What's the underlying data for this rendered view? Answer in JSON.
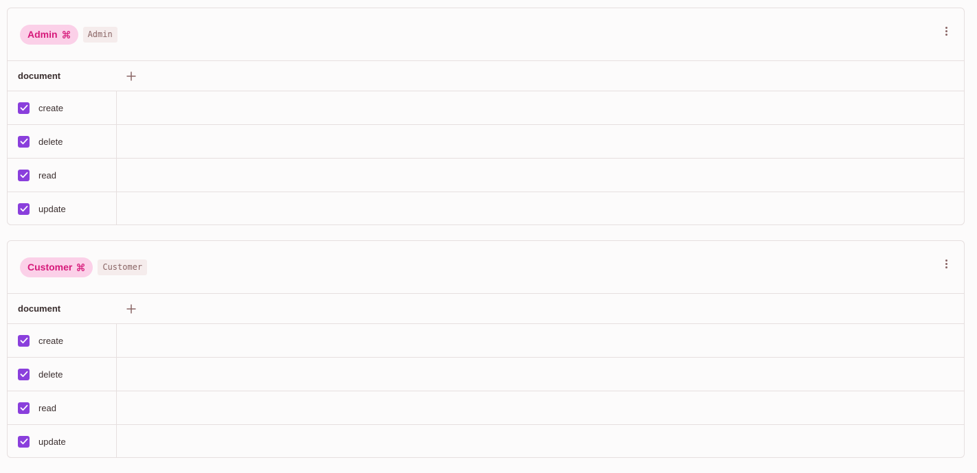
{
  "roles": [
    {
      "name": "Admin",
      "code": "Admin",
      "resource": "document",
      "permissions": [
        "create",
        "delete",
        "read",
        "update"
      ]
    },
    {
      "name": "Customer",
      "code": "Customer",
      "resource": "document",
      "permissions": [
        "create",
        "delete",
        "read",
        "update"
      ]
    }
  ],
  "colors": {
    "pill_bg": "#fbd0e8",
    "pill_text": "#d6197a",
    "checkbox": "#8a3fdc",
    "border": "#e6dfdf"
  },
  "icons": {
    "role_icon": "command-icon",
    "menu_icon": "more-vertical-icon",
    "add_icon": "plus-icon",
    "check_icon": "check-icon"
  }
}
